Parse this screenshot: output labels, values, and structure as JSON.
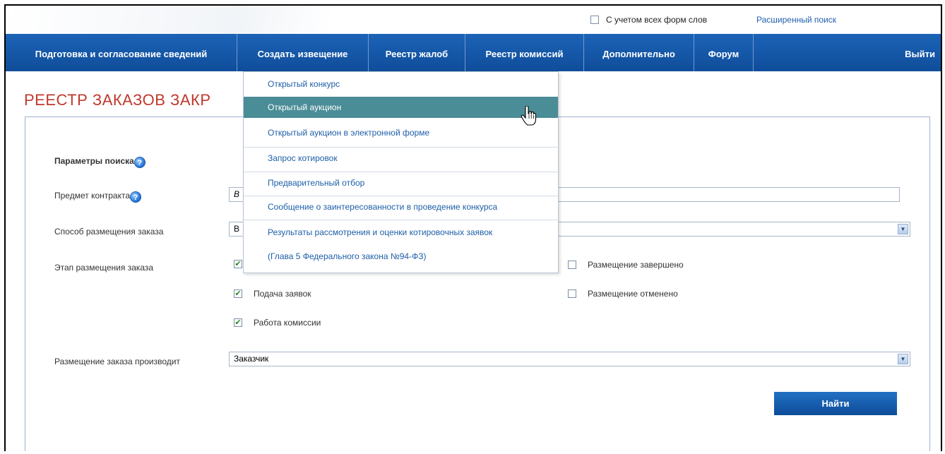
{
  "topbar": {
    "all_word_forms_label": "С учетом всех форм слов",
    "all_word_forms_checked": false,
    "advanced_search_link": "Расширенный поиск"
  },
  "nav": {
    "items": [
      {
        "label": "Подготовка и согласование сведений"
      },
      {
        "label": "Создать извещение"
      },
      {
        "label": "Реестр жалоб"
      },
      {
        "label": "Реестр комиссий"
      },
      {
        "label": "Дополнительно"
      },
      {
        "label": "Форум"
      }
    ],
    "logout": "Выйти"
  },
  "page": {
    "title": "РЕЕСТР ЗАКАЗОВ ЗАКР"
  },
  "dropdown": {
    "items": [
      "Открытый конкурс",
      "Открытый аукцион",
      "Открытый аукцион в электронной форме",
      "Запрос котировок",
      "Предварительный отбор",
      "Сообщение о заинтересованности в проведение конкурса",
      "Результаты рассмотрения и оценки котировочных заявок",
      "(Глава 5 Федерального закона №94-ФЗ)"
    ],
    "active_index": 1
  },
  "form": {
    "search_params_label": "Параметры поиска",
    "contract_subject_label": "Предмет контракта",
    "contract_subject_value": "В",
    "placement_method_label": "Способ размещения заказа",
    "placement_method_value": "В",
    "placement_stage_label": "Этап размещения заказа",
    "stages": [
      {
        "label": "Подача заявок",
        "checked": true
      },
      {
        "label": "Работа комиссии",
        "checked": true
      },
      {
        "label": "Размещение завершено",
        "checked": false
      },
      {
        "label": "Размещение отменено",
        "checked": false
      }
    ],
    "placed_by_label": "Размещение заказа производит",
    "placed_by_value": "Заказчик",
    "find_button": "Найти"
  },
  "colors": {
    "nav_bg": "#1658a8",
    "title_red": "#c0392b",
    "dropdown_active": "#4a8d97",
    "link_blue": "#1e5fa8"
  }
}
